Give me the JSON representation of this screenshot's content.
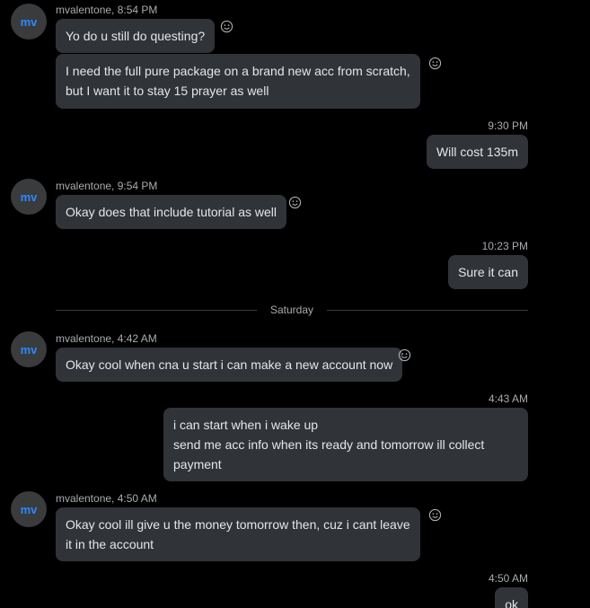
{
  "messages": [
    {
      "sender": "mvalentone, 8:54 PM",
      "avatar": "mv",
      "bubbles": [
        "Yo do u still do questing?",
        "I need the full pure package on a brand new acc from scratch,\nbut I want it to stay 15 prayer as well"
      ]
    },
    {
      "time": "9:30 PM",
      "bubbles": [
        "Will cost 135m"
      ]
    },
    {
      "sender": "mvalentone, 9:54 PM",
      "avatar": "mv",
      "bubbles": [
        "Okay does that include tutorial as well"
      ]
    },
    {
      "time": "10:23 PM",
      "bubbles": [
        "Sure it can"
      ]
    },
    {
      "sender": "mvalentone, 4:42 AM",
      "avatar": "mv",
      "bubbles": [
        "Okay cool when cna u start i can make a new account now"
      ]
    },
    {
      "time": "4:43 AM",
      "bubbles": [
        "i can start when i wake up\nsend me acc info when its ready and tomorrow ill collect\npayment"
      ]
    },
    {
      "sender": "mvalentone, 4:50 AM",
      "avatar": "mv",
      "bubbles": [
        "Okay cool ill give u the money tomorrow then, cuz i cant leave\nit in the account"
      ]
    },
    {
      "time": "4:50 AM",
      "bubbles": [
        "ok"
      ]
    }
  ],
  "divider": "Saturday",
  "colors": {
    "background": "#000000",
    "bubble": "#303338",
    "avatar_text": "#2d88ff",
    "meta_text": "#a8abaf"
  },
  "icons": {
    "reaction": "smiley-icon"
  }
}
